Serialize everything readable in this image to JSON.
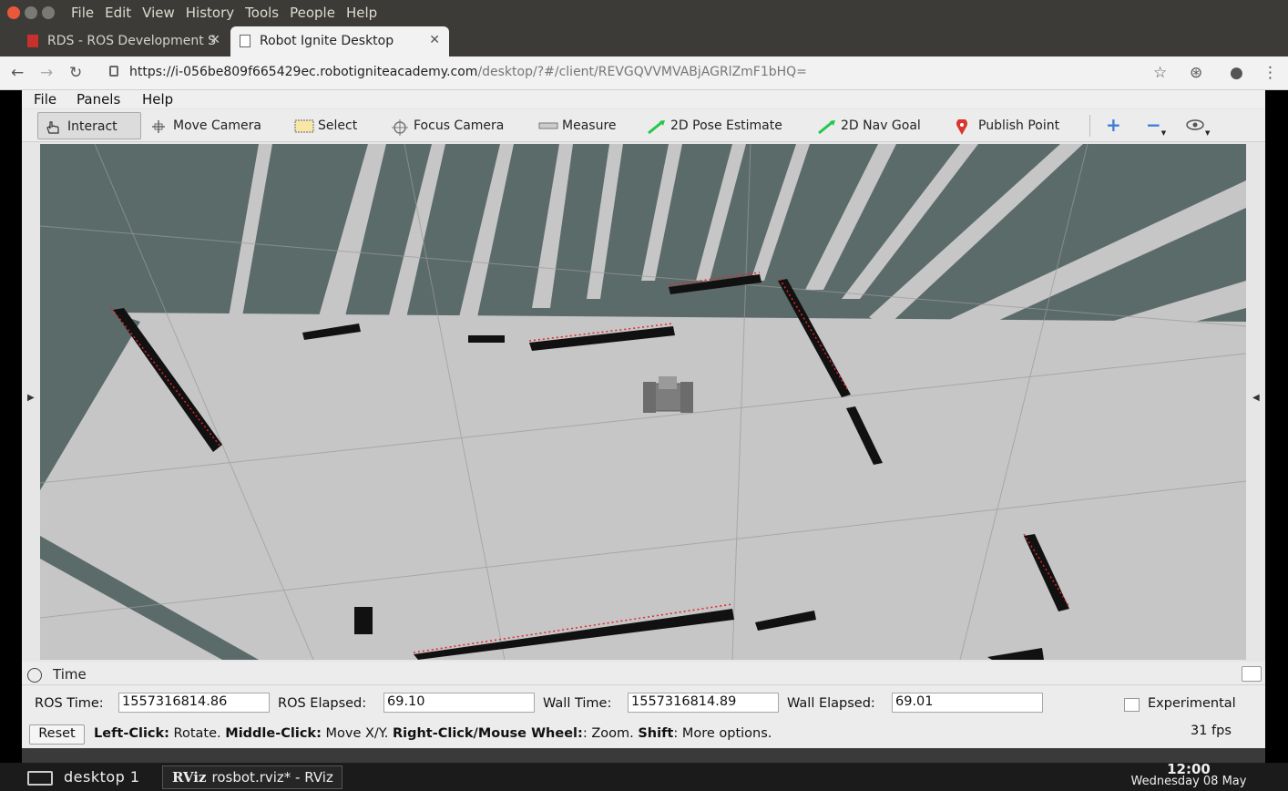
{
  "os_menu": [
    "File",
    "Edit",
    "View",
    "History",
    "Tools",
    "People",
    "Help"
  ],
  "tabs": [
    {
      "title": "RDS - ROS Development S",
      "close": "✕"
    },
    {
      "title": "Robot Ignite Desktop",
      "close": "✕"
    }
  ],
  "new_tab": "+",
  "address": {
    "url_host": "https://i-056be809f665429ec.robotigniteacademy.com",
    "url_path": "/desktop/?#/client/REVGQVVMVABjAGRlZmF1bHQ="
  },
  "rviz_menu": [
    "File",
    "Panels",
    "Help"
  ],
  "tools": [
    {
      "label": "Interact",
      "icon": "hand-pointer-icon"
    },
    {
      "label": "Move Camera",
      "icon": "move-camera-icon"
    },
    {
      "label": "Select",
      "icon": "select-box-icon"
    },
    {
      "label": "Focus Camera",
      "icon": "focus-camera-icon"
    },
    {
      "label": "Measure",
      "icon": "ruler-icon"
    },
    {
      "label": "2D Pose Estimate",
      "icon": "green-arrow-icon"
    },
    {
      "label": "2D Nav Goal",
      "icon": "green-arrow-icon"
    },
    {
      "label": "Publish Point",
      "icon": "map-pin-icon"
    }
  ],
  "time_panel": {
    "title": "Time",
    "ros_time_label": "ROS Time:",
    "ros_time": "1557316814.86",
    "ros_elapsed_label": "ROS Elapsed:",
    "ros_elapsed": "69.10",
    "wall_time_label": "Wall Time:",
    "wall_time": "1557316814.89",
    "wall_elapsed_label": "Wall Elapsed:",
    "wall_elapsed": "69.01",
    "experimental_label": "Experimental"
  },
  "status_bar": {
    "reset_label": "Reset",
    "left_click": "Left-Click:",
    "left_click_desc": " Rotate. ",
    "middle_click": "Middle-Click:",
    "middle_click_desc": " Move X/Y. ",
    "right_click": "Right-Click/Mouse Wheel:",
    "right_click_desc": ": Zoom. ",
    "shift": "Shift",
    "shift_desc": ": More options.",
    "fps": "31 fps"
  },
  "taskbar": {
    "desktop_label": "desktop 1",
    "task_icon_text": "RViz",
    "task_label": "rosbot.rviz* - RViz",
    "clock_time": "12:00",
    "clock_date": "Wednesday 08 May"
  },
  "colors": {
    "unknown_space": "#5b6b69",
    "free_space": "#c6c6c6",
    "obstacle": "#111111",
    "laser": "#e8232a"
  }
}
